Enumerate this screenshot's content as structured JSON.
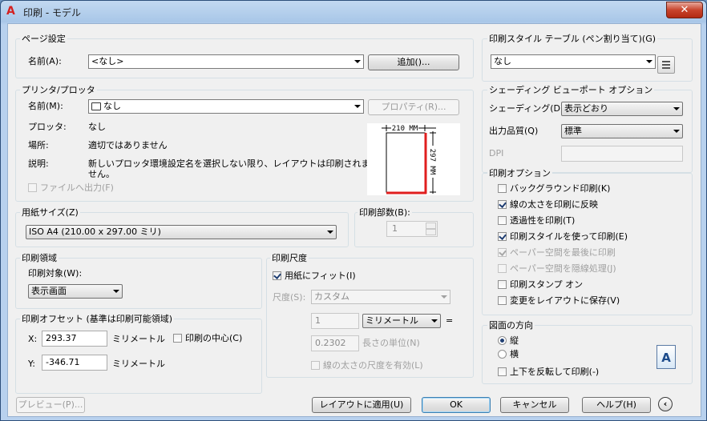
{
  "window": {
    "title": "印刷 - モデル",
    "app_icon": "A",
    "close_symbol": "✕"
  },
  "page_setup": {
    "legend": "ページ設定",
    "name_label": "名前(A):",
    "name_value": "<なし>",
    "add_button": "追加()..."
  },
  "printer": {
    "legend": "プリンタ/プロッタ",
    "name_label": "名前(M):",
    "name_value": "なし",
    "properties_button": "プロパティ(R)...",
    "plotter_label": "プロッタ:",
    "plotter_value": "なし",
    "location_label": "場所:",
    "location_value": "適切ではありません",
    "description_label": "説明:",
    "description_value_1": "新しいプロッタ環境設定名を選択しない限り、レイアウトは印刷されま",
    "description_value_2": "せん。",
    "print_to_file": "ファイルへ出力(F)",
    "preview_width": "210 MM",
    "preview_height": "297 MM"
  },
  "paper_size": {
    "legend": "用紙サイズ(Z)",
    "value": "ISO A4 (210.00 x 297.00 ミリ)"
  },
  "copies": {
    "legend": "印刷部数(B):",
    "value": "1"
  },
  "plot_area": {
    "legend": "印刷領域",
    "target_label": "印刷対象(W):",
    "target_value": "表示画面"
  },
  "plot_offset": {
    "legend": "印刷オフセット (基準は印刷可能領域)",
    "x_label": "X:",
    "x_value": "293.37",
    "x_unit": "ミリメートル",
    "y_label": "Y:",
    "y_value": "-346.71",
    "y_unit": "ミリメートル",
    "center_label": "印刷の中心(C)"
  },
  "plot_scale": {
    "legend": "印刷尺度",
    "fit_label": "用紙にフィット(I)",
    "scale_label": "尺度(S):",
    "scale_value": "カスタム",
    "unit_value_1": "1",
    "unit_combo": "ミリメートル",
    "equals": "=",
    "unit_value_2": "0.2302",
    "length_unit_label": "長さの単位(N)",
    "scale_lineweights": "線の太さの尺度を有効(L)"
  },
  "plot_style_table": {
    "legend": "印刷スタイル テーブル (ペン割り当て)(G)",
    "value": "なし"
  },
  "shaded_viewport": {
    "legend": "シェーディング ビューポート オプション",
    "shade_label": "シェーディング(D)",
    "shade_value": "表示どおり",
    "quality_label": "出力品質(Q)",
    "quality_value": "標準",
    "dpi_label": "DPI"
  },
  "plot_options": {
    "legend": "印刷オプション",
    "items": [
      {
        "label": "バックグラウンド印刷(K)",
        "checked": false,
        "disabled": false
      },
      {
        "label": "線の太さを印刷に反映",
        "checked": true,
        "disabled": false
      },
      {
        "label": "透過性を印刷(T)",
        "checked": false,
        "disabled": false
      },
      {
        "label": "印刷スタイルを使って印刷(E)",
        "checked": true,
        "disabled": false
      },
      {
        "label": "ペーパー空間を最後に印刷",
        "checked": true,
        "disabled": true
      },
      {
        "label": "ペーパー空間を隠線処理(J)",
        "checked": false,
        "disabled": true
      },
      {
        "label": "印刷スタンプ オン",
        "checked": false,
        "disabled": false
      },
      {
        "label": "変更をレイアウトに保存(V)",
        "checked": false,
        "disabled": false
      }
    ]
  },
  "orientation": {
    "legend": "図面の方向",
    "portrait": "縦",
    "landscape": "横",
    "upside_down": "上下を反転して印刷(-)",
    "icon_letter": "A"
  },
  "footer": {
    "preview_button": "プレビュー(P)...",
    "apply_button": "レイアウトに適用(U)",
    "ok_button": "OK",
    "cancel_button": "キャンセル",
    "help_button": "ヘルプ(H)",
    "back_symbol": "‹"
  },
  "colors": {
    "accent_red": "#e01e1e",
    "title_bg": "#b9d1ee"
  }
}
